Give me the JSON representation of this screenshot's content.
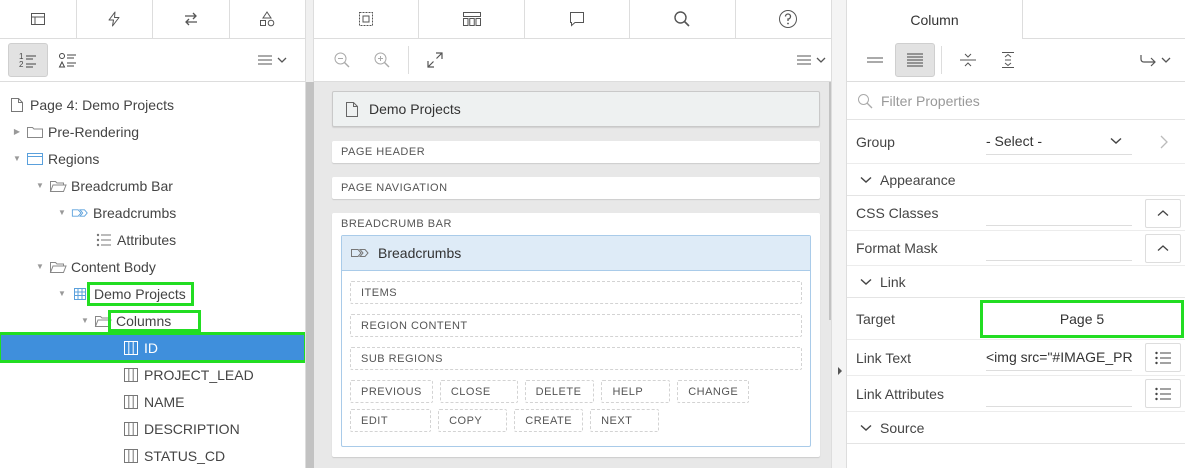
{
  "left": {
    "tree": [
      {
        "label": "Page 4: Demo Projects",
        "icon": "page-icon"
      },
      {
        "label": "Pre-Rendering",
        "icon": "folder-icon"
      },
      {
        "label": "Regions",
        "icon": "region-icon"
      },
      {
        "label": "Breadcrumb Bar",
        "icon": "folder-open-icon"
      },
      {
        "label": "Breadcrumbs",
        "icon": "breadcrumb-icon"
      },
      {
        "label": "Attributes",
        "icon": "attributes-icon"
      },
      {
        "label": "Content Body",
        "icon": "folder-open-icon"
      },
      {
        "label": "Demo Projects",
        "icon": "report-grid-icon"
      },
      {
        "label": "Columns",
        "icon": "folder-open-icon"
      },
      {
        "label": "ID",
        "icon": "column-icon"
      },
      {
        "label": "PROJECT_LEAD",
        "icon": "column-icon"
      },
      {
        "label": "NAME",
        "icon": "column-icon"
      },
      {
        "label": "DESCRIPTION",
        "icon": "column-icon"
      },
      {
        "label": "STATUS_CD",
        "icon": "column-icon"
      }
    ]
  },
  "center": {
    "page_title": "Demo Projects",
    "page_header": "PAGE HEADER",
    "page_navigation": "PAGE NAVIGATION",
    "breadcrumb_bar": "BREADCRUMB BAR",
    "region_title": "Breadcrumbs",
    "items": "ITEMS",
    "region_content": "REGION CONTENT",
    "sub_regions": "SUB REGIONS",
    "buttons_row1": [
      "PREVIOUS",
      "CLOSE",
      "DELETE",
      "HELP",
      "CHANGE"
    ],
    "buttons_row2": [
      "EDIT",
      "COPY",
      "CREATE",
      "NEXT"
    ]
  },
  "right": {
    "tab_label": "Column",
    "filter_placeholder": "Filter Properties",
    "group_label": "Group",
    "group_value": "- Select -",
    "appearance": "Appearance",
    "css_classes": "CSS Classes",
    "format_mask": "Format Mask",
    "link": "Link",
    "target": "Target",
    "target_value": "Page 5",
    "link_text": "Link Text",
    "link_text_value": "<img src=\"#IMAGE_PR",
    "link_attributes": "Link Attributes",
    "source": "Source"
  },
  "colors": {
    "selected": "#3f8fdc",
    "highlight": "#22dd22",
    "region_header": "#deebf7"
  }
}
